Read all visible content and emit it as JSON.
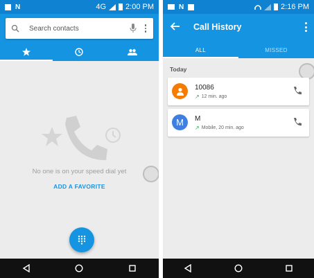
{
  "left": {
    "status": {
      "network": "4G",
      "time": "2:00 PM"
    },
    "search": {
      "placeholder": "Search contacts"
    },
    "tabs": [
      {
        "icon": "star-icon",
        "active": true
      },
      {
        "icon": "clock-icon",
        "active": false
      },
      {
        "icon": "contacts-icon",
        "active": false
      }
    ],
    "empty_text": "No one is on your speed dial yet",
    "add_favorite": "ADD A FAVORITE"
  },
  "right": {
    "status": {
      "time": "2:16 PM"
    },
    "title": "Call History",
    "tabs": [
      {
        "label": "ALL",
        "active": true
      },
      {
        "label": "MISSED",
        "active": false
      }
    ],
    "section": "Today",
    "calls": [
      {
        "name": "10086",
        "detail": "12 min. ago",
        "avatar_letter": "",
        "avatar_color": "#f57c00"
      },
      {
        "name": "M",
        "detail": "Mobile, 20 min. ago",
        "avatar_letter": "M",
        "avatar_color": "#3f7fe0"
      }
    ]
  },
  "colors": {
    "primary": "#1594e1",
    "status_bar": "#0f82d1",
    "navbar": "#111111"
  }
}
